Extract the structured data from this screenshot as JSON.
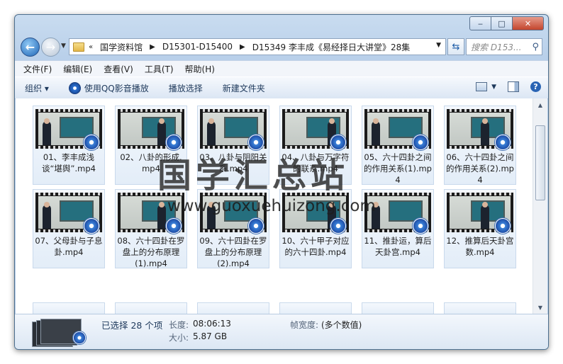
{
  "window": {
    "minimize": "‒",
    "maximize": "□",
    "close": "✕"
  },
  "address": {
    "chevron": "«",
    "crumbs": [
      "国学资料馆",
      "D15301-D15400",
      "D15349 李丰成《易经择日大讲堂》28集"
    ],
    "search_placeholder": "搜索 D153..."
  },
  "menu": [
    "文件(F)",
    "编辑(E)",
    "查看(V)",
    "工具(T)",
    "帮助(H)"
  ],
  "toolbar": {
    "organize": "组织 ▾",
    "play_qq": "使用QQ影音播放",
    "play_selection": "播放选择",
    "new_folder": "新建文件夹"
  },
  "files": [
    {
      "name": "01、李丰成浅谈“堪舆”.mp4"
    },
    {
      "name": "02、八卦的形成.mp4"
    },
    {
      "name": "03、八卦与阴阳关系.mp4"
    },
    {
      "name": "04、八卦与万字符的联系.mp4"
    },
    {
      "name": "05、六十四卦之间的作用关系(1).mp4"
    },
    {
      "name": "06、六十四卦之间的作用关系(2).mp4"
    },
    {
      "name": "07、父母卦与子息卦.mp4"
    },
    {
      "name": "08、六十四卦在罗盘上的分布原理(1).mp4"
    },
    {
      "name": "09、六十四卦在罗盘上的分布原理(2).mp4"
    },
    {
      "name": "10、六十甲子对应的六十四卦.mp4"
    },
    {
      "name": "11、推卦运，算后天卦宫.mp4"
    },
    {
      "name": "12、推算后天卦宫数.mp4"
    }
  ],
  "watermark": {
    "cn": "国学汇总站",
    "url": "www.guoxuehuizong.com"
  },
  "details": {
    "selected": "已选择 28 个项",
    "length_label": "长度:",
    "length_value": "08:06:13",
    "size_label": "大小:",
    "size_value": "5.87 GB",
    "width_label": "帧宽度:",
    "width_value": "(多个数值)"
  }
}
